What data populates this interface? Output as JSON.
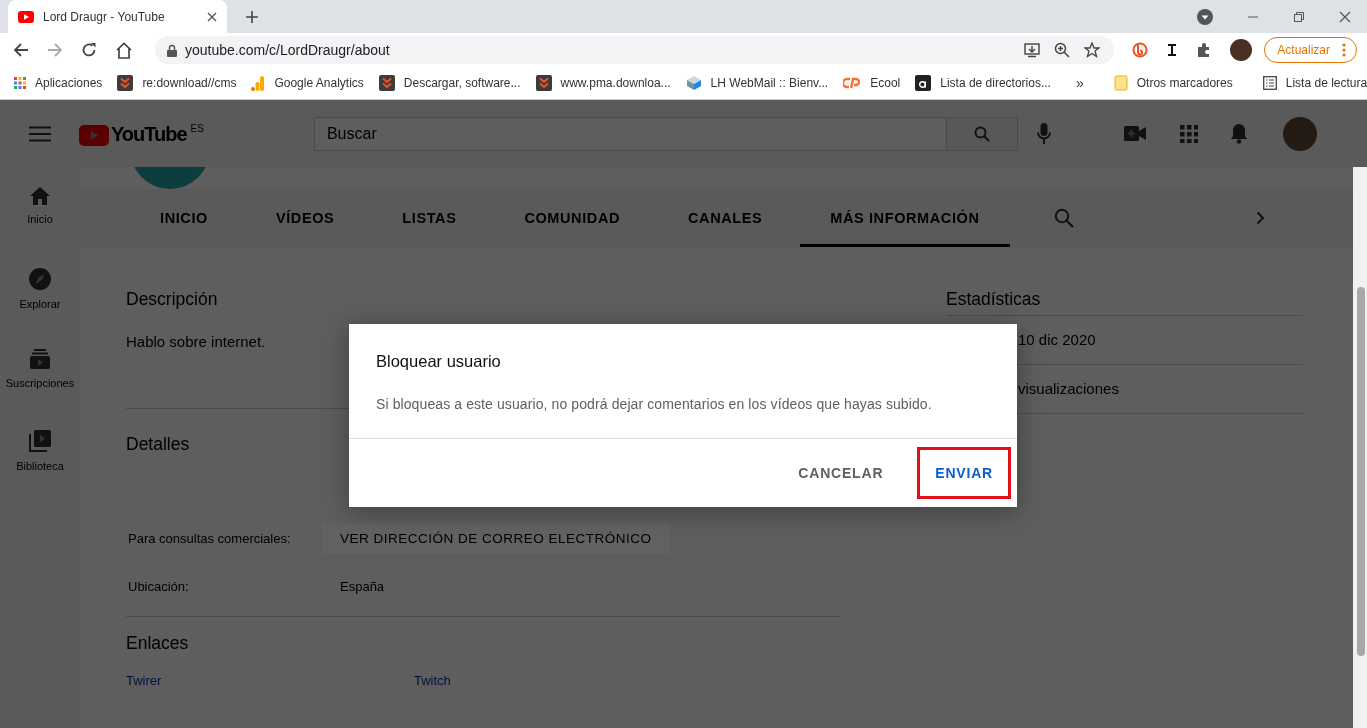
{
  "browser": {
    "tab_title": "Lord Draugr - YouTube",
    "address": "youtube.com/c/LordDraugr/about",
    "update_button": "Actualizar",
    "bookmarks": [
      {
        "label": "Aplicaciones",
        "kind": "apps"
      },
      {
        "label": "re:download//cms",
        "kind": "download"
      },
      {
        "label": "Google Analytics",
        "kind": "analytics"
      },
      {
        "label": "Descargar, software...",
        "kind": "download"
      },
      {
        "label": "www.pma.downloa...",
        "kind": "download"
      },
      {
        "label": "LH WebMail :: Bienv...",
        "kind": "mail"
      },
      {
        "label": "Ecool",
        "kind": "cpanel"
      },
      {
        "label": "Lista de directorios...",
        "kind": "letter"
      }
    ],
    "overflow": "»",
    "other_bookmarks": "Otros marcadores",
    "reading_list": "Lista de lectura"
  },
  "youtube": {
    "logo_text": "YouTube",
    "country": "ES",
    "search": {
      "placeholder": "Buscar"
    },
    "sidebar": [
      {
        "label": "Inicio",
        "kind": "home"
      },
      {
        "label": "Explorar",
        "kind": "explore"
      },
      {
        "label": "Suscripciones",
        "kind": "subscriptions"
      },
      {
        "label": "Biblioteca",
        "kind": "library"
      }
    ],
    "tabs": [
      {
        "label": "INICIO",
        "selected": false
      },
      {
        "label": "VÍDEOS",
        "selected": false
      },
      {
        "label": "LISTAS",
        "selected": false
      },
      {
        "label": "COMUNIDAD",
        "selected": false
      },
      {
        "label": "CANALES",
        "selected": false
      },
      {
        "label": "MÁS INFORMACIÓN",
        "selected": true
      }
    ],
    "description": {
      "title": "Descripción",
      "text": "Hablo sobre internet."
    },
    "details": {
      "title": "Detalles",
      "rows": [
        {
          "label": "Para consultas comerciales:",
          "value": "VER DIRECCIÓN DE CORREO ELECTRÓNICO",
          "kind": "button"
        },
        {
          "label": "Ubicación:",
          "value": "España",
          "kind": "text"
        }
      ]
    },
    "links": {
      "title": "Enlaces",
      "items": [
        "Twirer",
        "Twitch"
      ]
    },
    "stats": {
      "title": "Estadísticas",
      "rows": [
        "10 dic 2020",
        "visualizaciones"
      ]
    }
  },
  "dialog": {
    "title": "Bloquear usuario",
    "message": "Si bloqueas a este usuario, no podrá dejar comentarios en los vídeos que hayas subido.",
    "buttons": [
      {
        "label": "CANCELAR",
        "highlighted": false
      },
      {
        "label": "ENVIAR",
        "highlighted": true
      }
    ]
  }
}
